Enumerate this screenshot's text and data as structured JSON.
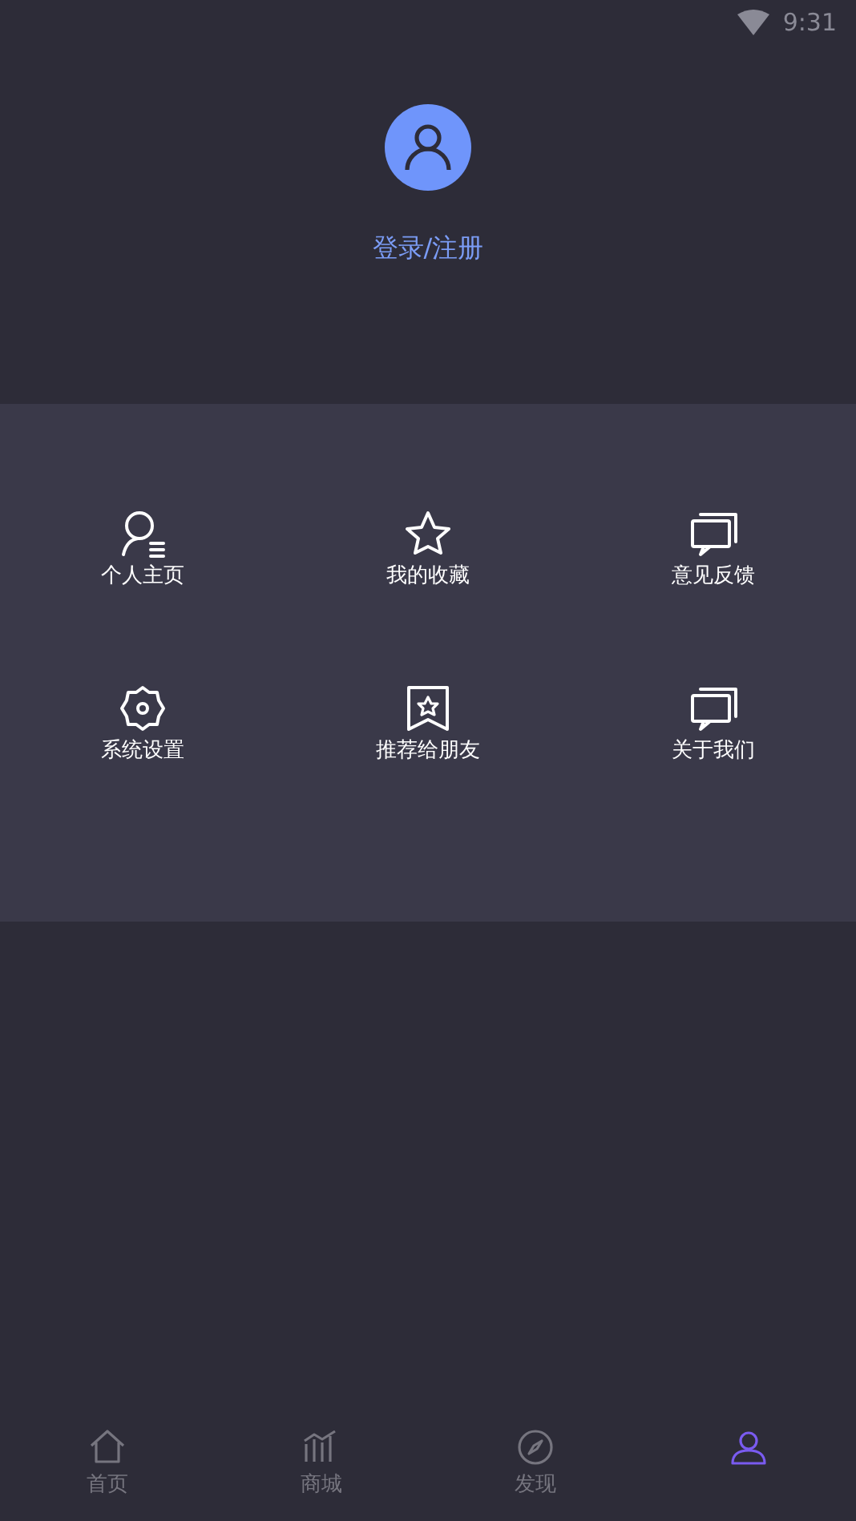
{
  "status_bar": {
    "time": "9:31"
  },
  "profile": {
    "login_label": "登录/注册"
  },
  "menu": [
    {
      "kind": "profile",
      "label": "个人主页"
    },
    {
      "kind": "star",
      "label": "我的收藏"
    },
    {
      "kind": "chat",
      "label": "意见反馈"
    },
    {
      "kind": "gear",
      "label": "系统设置"
    },
    {
      "kind": "bookmark",
      "label": "推荐给朋友"
    },
    {
      "kind": "chat",
      "label": "关于我们"
    }
  ],
  "tab_bar": [
    {
      "kind": "home",
      "label": "首页",
      "selected": false
    },
    {
      "kind": "chart",
      "label": "商城",
      "selected": false
    },
    {
      "kind": "compass",
      "label": "发现",
      "selected": false
    },
    {
      "kind": "person",
      "selected": true
    }
  ]
}
